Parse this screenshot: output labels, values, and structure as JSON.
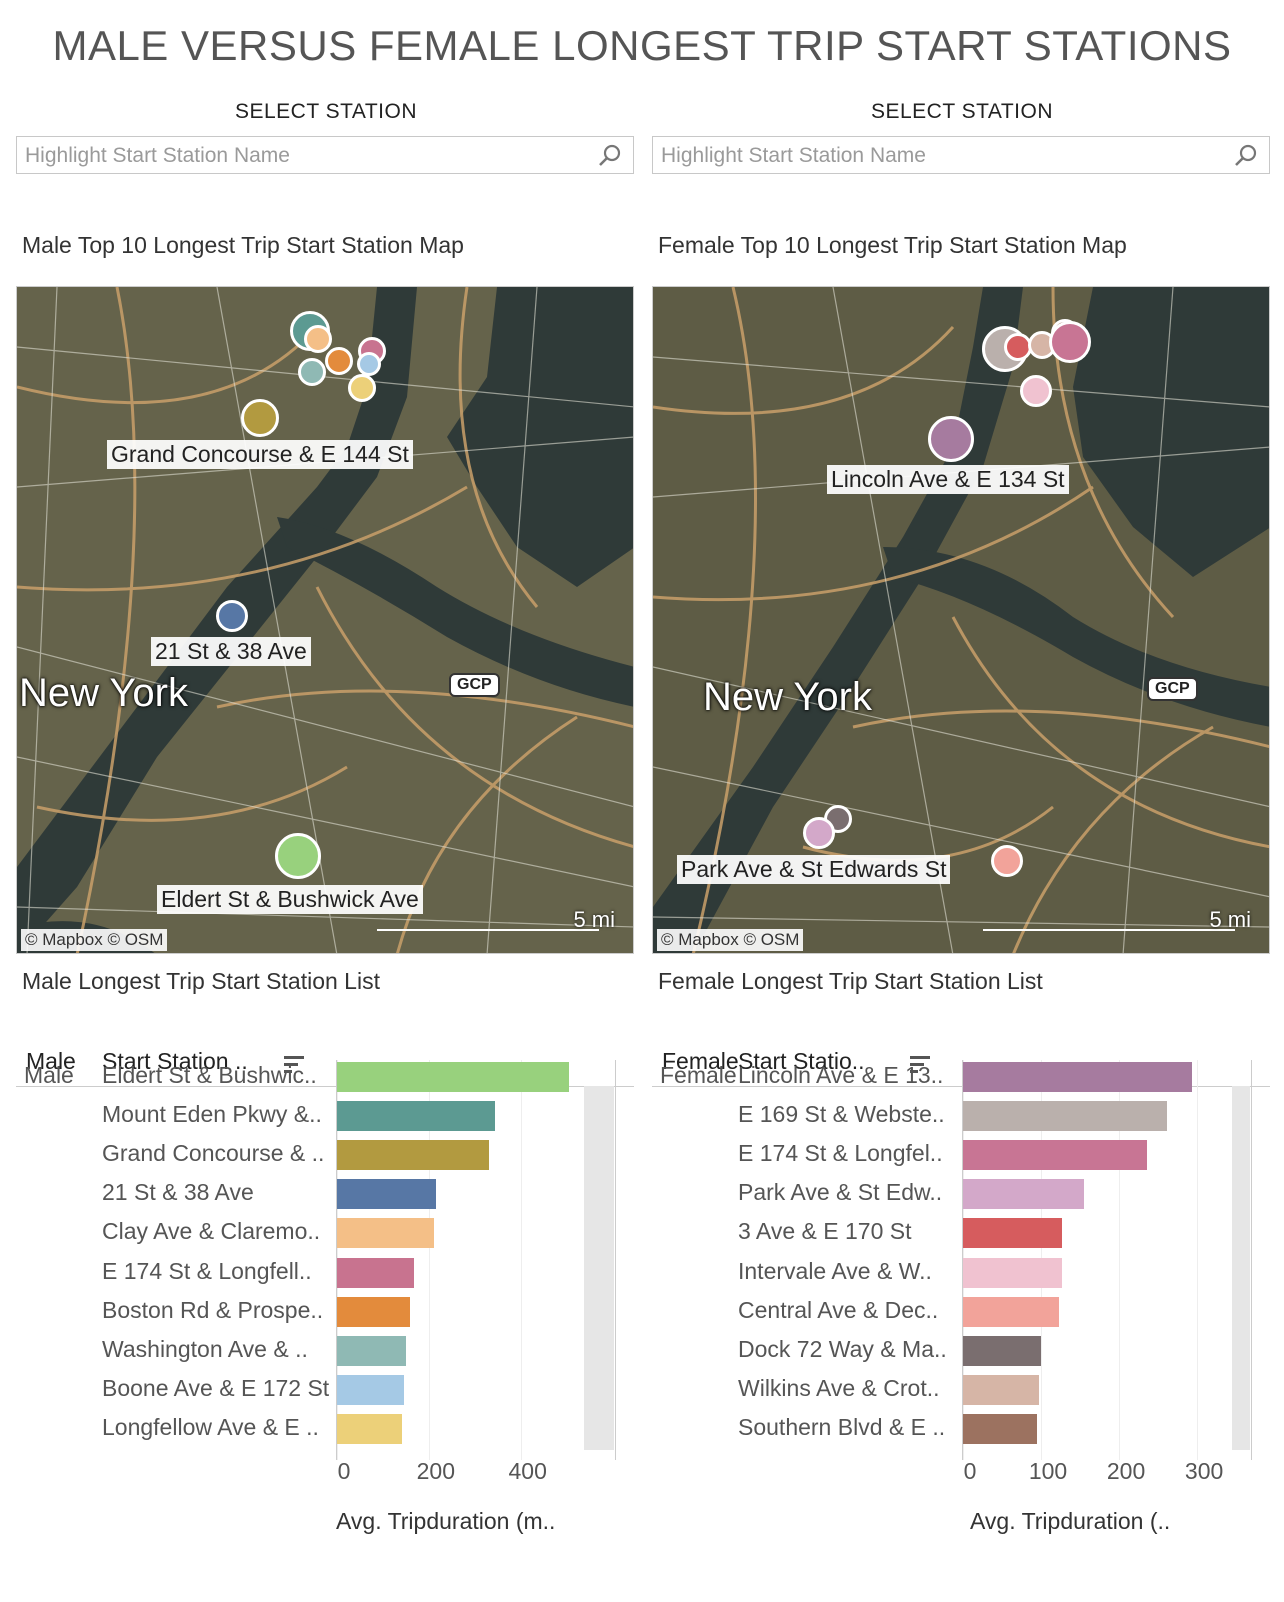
{
  "title": "MALE VERSUS FEMALE LONGEST TRIP START STATIONS",
  "colors": {
    "male": [
      "#98d17d",
      "#5c9a92",
      "#b29a40",
      "#5777a5",
      "#f4bf87",
      "#c8738f",
      "#e38b3c",
      "#8fb9b4",
      "#a5c9e5",
      "#ecd079"
    ],
    "female": [
      "#a67b9f",
      "#bab0ac",
      "#c87594",
      "#d3a8c9",
      "#d65c5e",
      "#f0c2d0",
      "#f2a39a",
      "#7a6e6f",
      "#d6b5a6",
      "#9c7260"
    ]
  },
  "panels": {
    "male": {
      "select_label": "SELECT STATION",
      "search_placeholder": "Highlight Start Station Name",
      "map_title": "Male Top 10 Longest Trip Start Station Map",
      "map": {
        "city": "New York",
        "labels": [
          "Grand Concourse & E 144 St",
          "21 St & 38 Ave",
          "Eldert St & Bushwick Ave"
        ],
        "gcp": "GCP",
        "attribution": "© Mapbox  © OSM",
        "scale": "5 mi"
      },
      "list_title": "Male Longest Trip Start Station List",
      "col_dim": "Male",
      "col_station": "Start Station ..",
      "dim_value": "Male",
      "axis_title": "Avg. Tripduration (m..",
      "ticks": [
        "0",
        "200",
        "400"
      ]
    },
    "female": {
      "select_label": "SELECT STATION",
      "search_placeholder": "Highlight Start Station Name",
      "map_title": "Female Top 10 Longest Trip Start Station Map",
      "map": {
        "city": "New York",
        "labels": [
          "Lincoln Ave & E 134 St",
          "Park Ave & St Edwards St"
        ],
        "gcp": "GCP",
        "attribution": "© Mapbox  © OSM",
        "scale": "5 mi"
      },
      "list_title": "Female Longest Trip Start Station List",
      "col_dim": "Female",
      "col_station": "Start Statio..",
      "dim_value": "Female",
      "axis_title": "Avg. Tripduration (..",
      "ticks": [
        "0",
        "100",
        "200",
        "300"
      ]
    }
  },
  "chart_data": [
    {
      "type": "bar",
      "orientation": "horizontal",
      "title": "Male Longest Trip Start Station List",
      "xlabel": "Avg. Tripduration (m..",
      "xlim": [
        0,
        560
      ],
      "categories": [
        "Eldert St & Bushwic..",
        "Mount Eden Pkwy &..",
        "Grand Concourse & ..",
        "21 St & 38 Ave",
        "Clay Ave & Claremo..",
        "E 174 St & Longfell..",
        "Boston Rd & Prospe..",
        "Washington Ave & ..",
        "Boone Ave & E 172 St",
        "Longfellow Ave & E .."
      ],
      "values": [
        505,
        343,
        330,
        215,
        212,
        167,
        158,
        150,
        145,
        142
      ]
    },
    {
      "type": "bar",
      "orientation": "horizontal",
      "title": "Female Longest Trip Start Station List",
      "xlabel": "Avg. Tripduration (..",
      "xlim": [
        0,
        310
      ],
      "categories": [
        "Lincoln Ave & E 13..",
        "E 169 St & Webste..",
        "E 174 St & Longfel..",
        "Park Ave & St Edw..",
        "3 Ave & E 170 St",
        "Intervale Ave & W..",
        "Central Ave & Dec..",
        "Dock 72 Way & Ma..",
        "Wilkins Ave & Crot..",
        "Southern Blvd & E .."
      ],
      "values": [
        293,
        262,
        236,
        155,
        127,
        127,
        123,
        100,
        98,
        95
      ]
    }
  ]
}
